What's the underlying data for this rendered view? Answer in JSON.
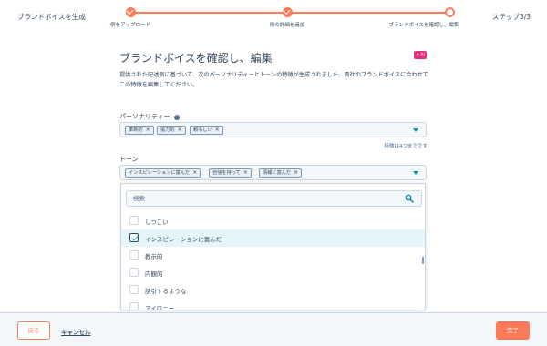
{
  "header": {
    "app_title": "ブランドボイスを生成",
    "step_indicator": "ステップ3/3",
    "steps": [
      {
        "label": "例をアップロード",
        "status": "done"
      },
      {
        "label": "例の詳細を追加",
        "status": "done"
      },
      {
        "label": "ブランドボイスを確認し、編集",
        "status": "current"
      }
    ],
    "accent_color": "#ff7a59"
  },
  "main": {
    "title": "ブランドボイスを確認し、編集",
    "ai_badge": "✦ AI",
    "description": "提供された記述例に基づいて、次のパーソナリティーとトーンの特徴が生成されました。貴社のブランドボイスに合わせてこの特徴を編集してください。",
    "personality": {
      "label": "パーソナリティー",
      "tags": [
        "革新的",
        "協力的",
        "頼もしい"
      ],
      "hint": "特徴は4つまでです"
    },
    "tone": {
      "label": "トーン",
      "tags": [
        "インスピレーションに富んだ",
        "自信を持って",
        "情報に富んだ"
      ]
    },
    "dropdown": {
      "search_placeholder": "検索",
      "options": [
        {
          "label": "しつこい",
          "checked": false
        },
        {
          "label": "インスピレーションに富んだ",
          "checked": true
        },
        {
          "label": "教示的",
          "checked": false
        },
        {
          "label": "内観的",
          "checked": false
        },
        {
          "label": "誘引するような",
          "checked": false
        },
        {
          "label": "アイロニー",
          "checked": false
        }
      ]
    }
  },
  "footer": {
    "back_label": "戻る",
    "cancel_label": "キャンセル",
    "done_label": "完了"
  },
  "colors": {
    "accent": "#ff7a59",
    "ai_badge": "#e8307a",
    "checkbox_check": "#00a4bd",
    "selected_row": "#e5f5f8"
  }
}
